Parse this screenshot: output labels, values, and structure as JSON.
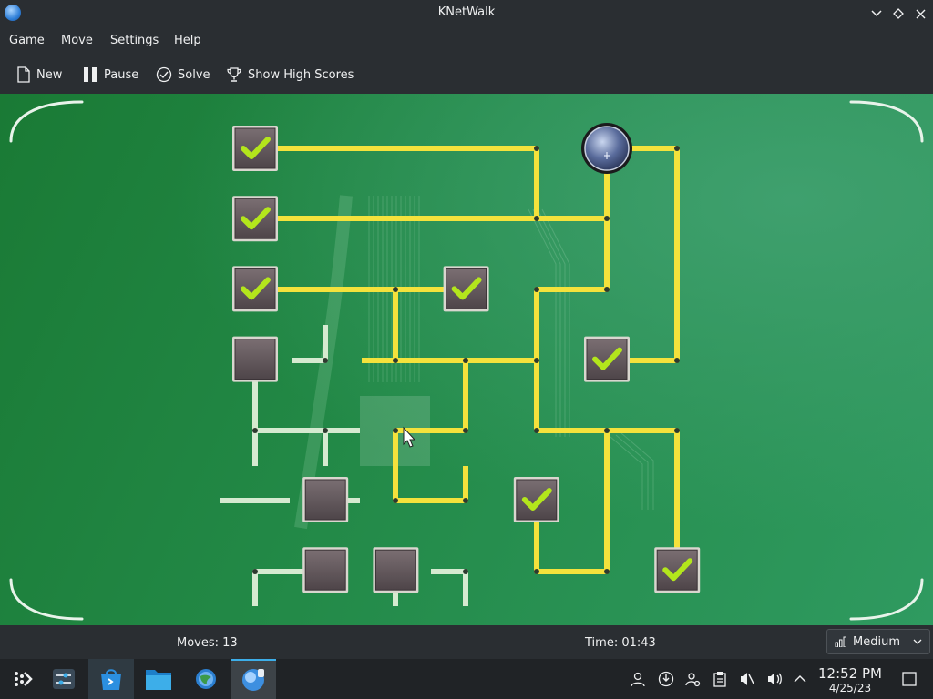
{
  "window": {
    "title": "KNetWalk"
  },
  "menu": {
    "items": [
      "Game",
      "Move",
      "Settings",
      "Help"
    ]
  },
  "toolbar": {
    "new_label": "New",
    "pause_label": "Pause",
    "solve_label": "Solve",
    "highscores_label": "Show High Scores"
  },
  "status": {
    "moves": "Moves: 13",
    "time": "Time: 01:43",
    "difficulty": "Medium"
  },
  "clock": {
    "time": "12:52 PM",
    "date": "4/25/23"
  },
  "colors": {
    "cable_connected": "#f4e23c",
    "cable_disconnected": "#d5ead0",
    "board_green": "#238a48",
    "check": "#b3e61c"
  },
  "taskbar": {
    "items": [
      "application-launcher-icon",
      "system-settings-icon",
      "discover-store-icon",
      "file-manager-icon",
      "settings-gear-icon",
      "knetwalk-icon"
    ]
  },
  "tray": {
    "items": [
      "user-icon",
      "updates-icon",
      "accounts-icon",
      "clipboard-icon",
      "muted-speaker-icon",
      "volume-icon",
      "expand-tray-icon"
    ]
  },
  "board": {
    "size": 7,
    "server": {
      "row": 0,
      "col": 5
    },
    "computers": [
      {
        "row": 0,
        "col": 0,
        "connected": true
      },
      {
        "row": 1,
        "col": 0,
        "connected": true
      },
      {
        "row": 2,
        "col": 0,
        "connected": true
      },
      {
        "row": 2,
        "col": 3,
        "connected": true
      },
      {
        "row": 3,
        "col": 0,
        "connected": false
      },
      {
        "row": 3,
        "col": 5,
        "connected": true
      },
      {
        "row": 5,
        "col": 1,
        "connected": false
      },
      {
        "row": 5,
        "col": 4,
        "connected": true
      },
      {
        "row": 6,
        "col": 1,
        "connected": false
      },
      {
        "row": 6,
        "col": 2,
        "connected": false
      },
      {
        "row": 6,
        "col": 6,
        "connected": true
      }
    ]
  }
}
